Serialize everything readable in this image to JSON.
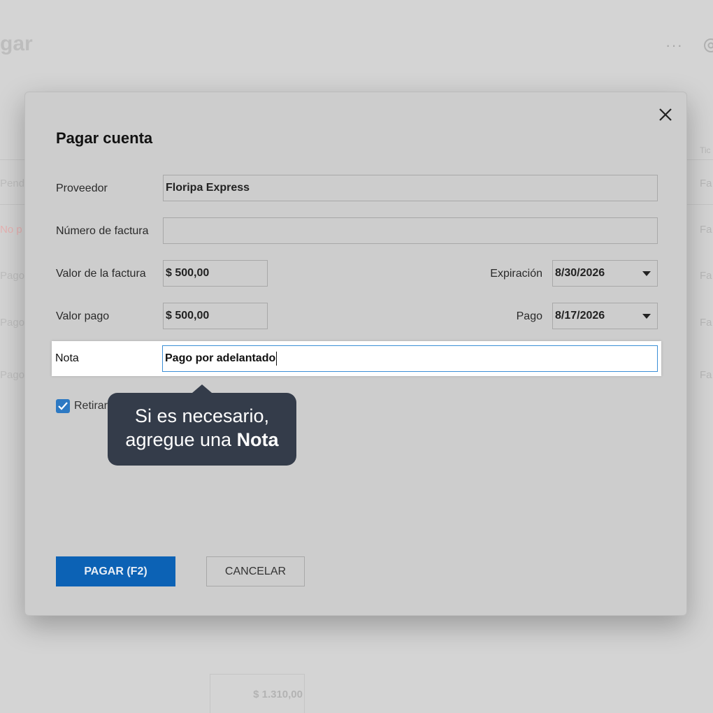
{
  "background": {
    "title": "gar",
    "more_label": "···",
    "rows_left": [
      {
        "text": "Pend",
        "tone": "grey"
      },
      {
        "text": "No p",
        "tone": "red"
      },
      {
        "text": "Pago",
        "tone": "grey"
      },
      {
        "text": "Pago",
        "tone": "grey"
      },
      {
        "text": "Pago",
        "tone": "grey"
      }
    ],
    "rows_right": [
      "Tic",
      "Fa",
      "Fa",
      "Fa",
      "Fa",
      "Fa"
    ],
    "total": "$ 1.310,00"
  },
  "modal": {
    "title": "Pagar cuenta",
    "fields": {
      "proveedor": {
        "label": "Proveedor",
        "value": "Floripa Express"
      },
      "numero_factura": {
        "label": "Número de factura",
        "value": ""
      },
      "valor_factura": {
        "label": "Valor de la factura",
        "value": "$ 500,00"
      },
      "expiracion": {
        "label": "Expiración",
        "value": "8/30/2026"
      },
      "valor_pago": {
        "label": "Valor pago",
        "value": "$ 500,00"
      },
      "pago": {
        "label": "Pago",
        "value": "8/17/2026"
      },
      "nota": {
        "label": "Nota",
        "value": "Pago por adelantado"
      }
    },
    "checkbox": {
      "label": "Retirar",
      "checked": true
    },
    "buttons": {
      "pay": "PAGAR (F2)",
      "cancel": "CANCELAR"
    }
  },
  "tooltip": {
    "line1": "Si es necesario,",
    "line2_prefix": "agregue una ",
    "line2_bold": "Nota"
  },
  "colors": {
    "primary": "#0c62b5",
    "tooltip_bg": "#343c4a",
    "focus_border": "#3b8fd6",
    "checkbox": "#2d79c3"
  }
}
